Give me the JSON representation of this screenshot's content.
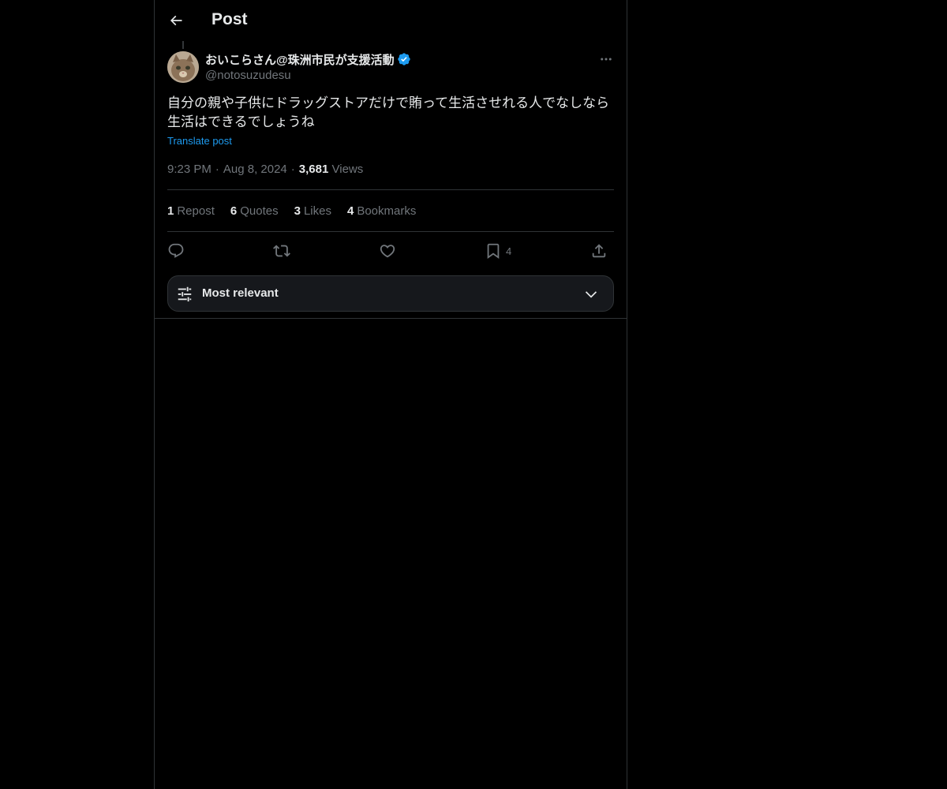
{
  "header": {
    "title": "Post"
  },
  "author": {
    "display_name": "おいこらさん@珠洲市民が支援活動",
    "handle": "@notosuzudesu",
    "verified": true
  },
  "post": {
    "text": "自分の親や子供にドラッグストアだけで賄って生活させれる人でなしなら\n生活はできるでしょうね",
    "translate_label": "Translate post",
    "time": "9:23 PM",
    "date": "Aug 8, 2024",
    "views_count": "3,681",
    "views_label": "Views",
    "separator": "·"
  },
  "stats": [
    {
      "count": "1",
      "label": "Repost"
    },
    {
      "count": "6",
      "label": "Quotes"
    },
    {
      "count": "3",
      "label": "Likes"
    },
    {
      "count": "4",
      "label": "Bookmarks"
    }
  ],
  "actions": {
    "reply_icon": "reply-icon",
    "repost_icon": "repost-icon",
    "like_icon": "heart-icon",
    "bookmark_icon": "bookmark-icon",
    "bookmark_count": "4",
    "share_icon": "share-icon"
  },
  "sort": {
    "label": "Most relevant"
  },
  "colors": {
    "background": "#000000",
    "text_primary": "#e7e9ea",
    "text_secondary": "#71767b",
    "accent": "#1d9bf0",
    "border": "#2f3336",
    "sort_bg": "#16181c"
  }
}
